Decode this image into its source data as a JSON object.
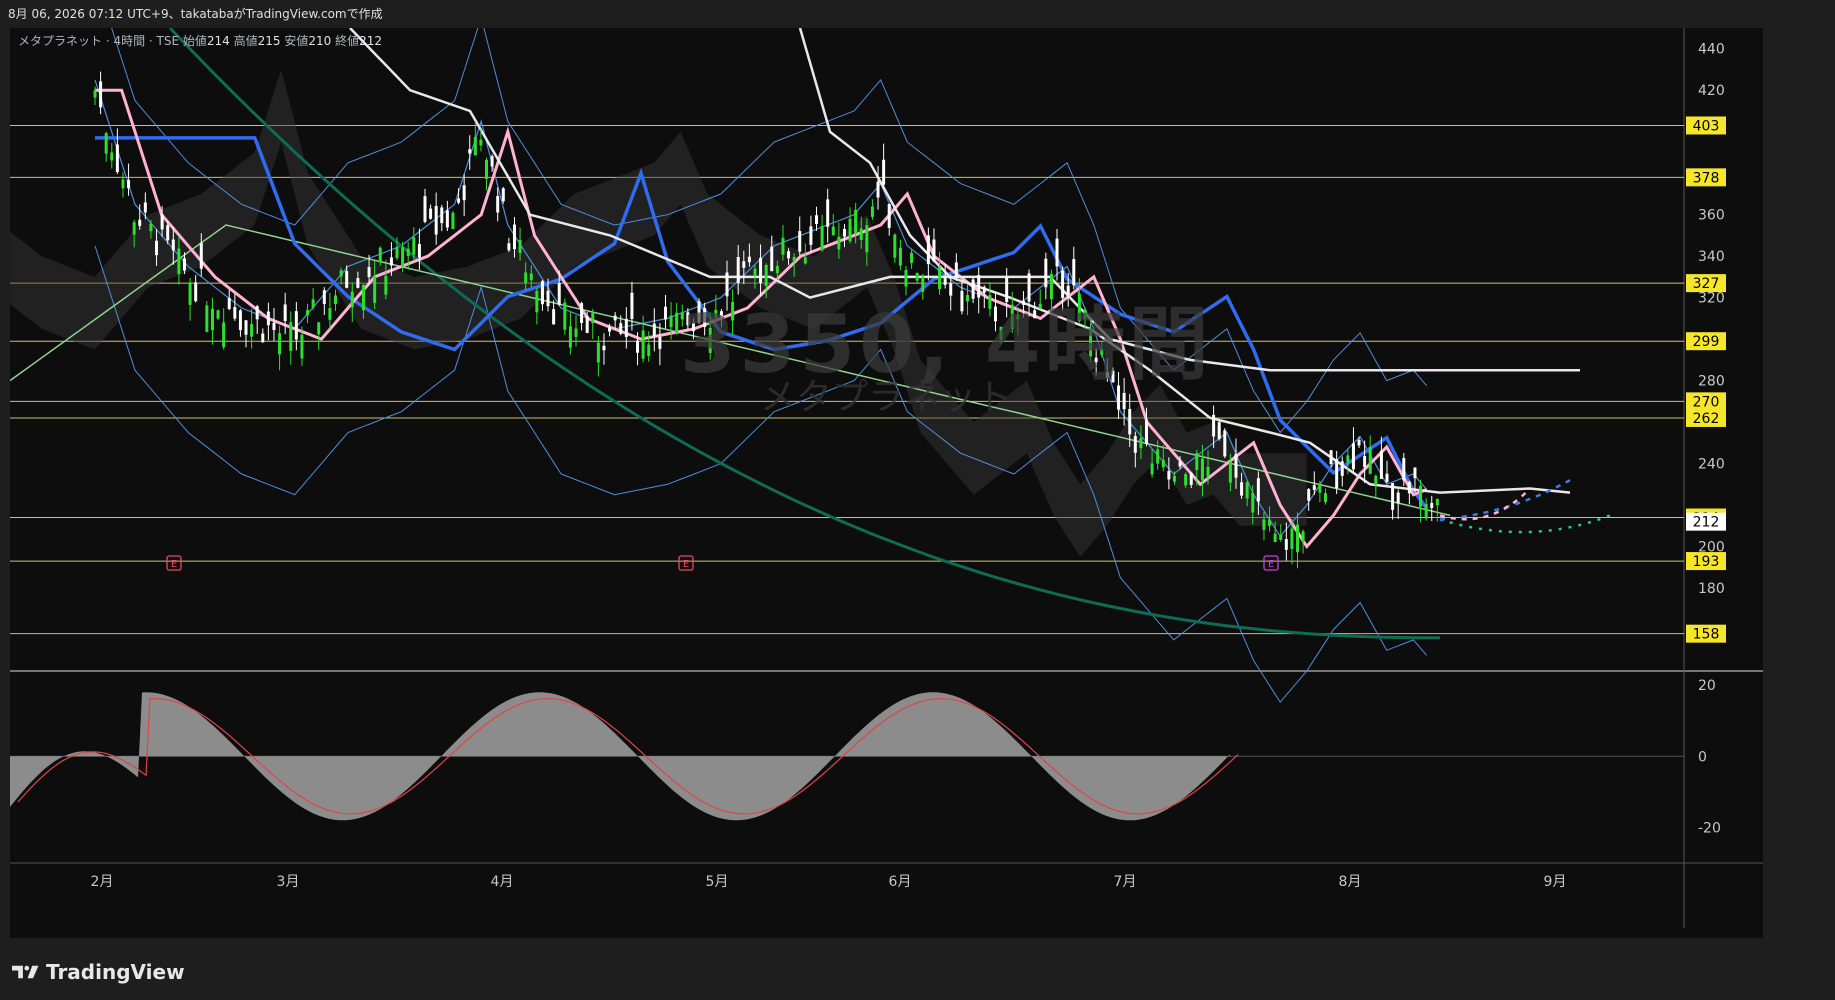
{
  "header": {
    "text": "8月 06, 2026 07:12 UTC+9、takatabaがTradingView.comで作成"
  },
  "symbol": {
    "name": "メタプラネット · 4時間 · TSE",
    "open_label": "始値",
    "open": "214",
    "high_label": "高値",
    "high": "215",
    "low_label": "安値",
    "low": "210",
    "close_label": "終値",
    "close": "212"
  },
  "watermark": {
    "main": "3350, 4時間",
    "sub": "メタプラネット"
  },
  "brand": {
    "name": "TradingView"
  },
  "colors": {
    "background": "#0d0d0d",
    "level_line": "#e6d37a",
    "level_box": "#f5e62a",
    "up_candle": "#2ee02e",
    "down_candle": "#ffffff",
    "ma_pink": "#ffb3d0",
    "ma_blue": "#2f6cf0",
    "ma_green_thin": "#8fd48f",
    "ma_teal": "#0e6b55",
    "bollinger": "#4f8ed8",
    "ichimoku_cloud": "#3a3a3a",
    "white_line": "#e8e8e8",
    "oscillator_fill": "#9a9a9a",
    "oscillator_signal": "#e04545",
    "earnings_marker": "#e84d5d",
    "earnings_marker_future": "#c244d6"
  },
  "chart_data": {
    "type": "candlestick",
    "title": "",
    "x_axis": {
      "months": [
        "2月",
        "3月",
        "4月",
        "5月",
        "6月",
        "7月",
        "8月",
        "9月"
      ]
    },
    "y_axis": {
      "ticks": [
        440,
        420,
        360,
        340,
        320,
        280,
        240,
        200,
        180
      ],
      "range": [
        140,
        450
      ],
      "current_price": 212
    },
    "horizontal_levels": [
      403,
      378,
      327,
      299,
      270,
      262,
      214,
      193,
      158
    ],
    "earnings_markers": [
      {
        "label": "E",
        "month_index": 0,
        "offset": 0.5
      },
      {
        "label": "E",
        "month_index": 3,
        "offset": 0.25
      },
      {
        "label": "E",
        "month_index": 6,
        "offset": 0.35
      }
    ],
    "price_path": [
      [
        0.05,
        420
      ],
      [
        0.08,
        360
      ],
      [
        0.12,
        330
      ],
      [
        0.16,
        310
      ],
      [
        0.2,
        300
      ],
      [
        0.24,
        330
      ],
      [
        0.28,
        340
      ],
      [
        0.32,
        360
      ],
      [
        0.34,
        400
      ],
      [
        0.36,
        350
      ],
      [
        0.4,
        310
      ],
      [
        0.44,
        300
      ],
      [
        0.48,
        305
      ],
      [
        0.52,
        315
      ],
      [
        0.56,
        340
      ],
      [
        0.58,
        345
      ],
      [
        0.62,
        355
      ],
      [
        0.64,
        370
      ],
      [
        0.66,
        340
      ],
      [
        0.7,
        320
      ],
      [
        0.74,
        310
      ],
      [
        0.78,
        330
      ],
      [
        0.8,
        300
      ],
      [
        0.82,
        260
      ],
      [
        0.86,
        230
      ],
      [
        0.88,
        240
      ],
      [
        0.9,
        250
      ],
      [
        0.92,
        220
      ],
      [
        0.94,
        200
      ],
      [
        0.96,
        215
      ],
      [
        0.98,
        235
      ],
      [
        1.0,
        248
      ],
      [
        1.02,
        225
      ],
      [
        1.04,
        230
      ],
      [
        1.06,
        215
      ]
    ],
    "oscillator": {
      "ticks": [
        20,
        0,
        -20
      ],
      "range": [
        -30,
        22
      ]
    }
  }
}
